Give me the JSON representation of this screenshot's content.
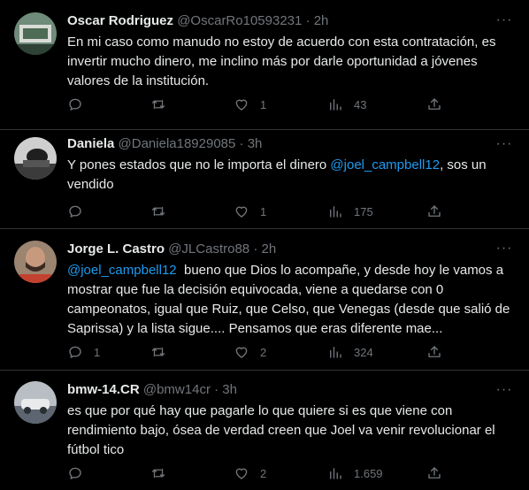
{
  "tweets": [
    {
      "name": "Oscar Rodriguez",
      "handle": "@OscarRo10593231",
      "separator": "·",
      "time": "2h",
      "text_parts": [
        {
          "text": "En mi caso como manudo no estoy de acuerdo con esta contratación, es invertir mucho dinero, me inclino más por darle oportunidad a jóvenes valores de la institución."
        }
      ],
      "replies": "",
      "retweets": "",
      "likes": "1",
      "views": "43",
      "avatar_colors": [
        "#4d6b55",
        "#d9dcd6"
      ]
    },
    {
      "name": "Daniela",
      "handle": "@Daniela18929085",
      "separator": "·",
      "time": "3h",
      "text_parts": [
        {
          "text": "Y pones estados que no le importa el dinero "
        },
        {
          "text": "@joel_campbell12",
          "mention": true
        },
        {
          "text": ", sos un vendido"
        }
      ],
      "replies": "",
      "retweets": "",
      "likes": "1",
      "views": "175",
      "avatar_colors": [
        "#3b3b3b",
        "#cfcfcf"
      ]
    },
    {
      "name": "Jorge L. Castro",
      "handle": "@JLCastro88",
      "separator": "·",
      "time": "2h",
      "text_parts": [
        {
          "text": "@joel_campbell12",
          "mention": true
        },
        {
          "text": "  bueno que Dios lo acompañe, y desde hoy le vamos a mostrar que fue la decisión equivocada, viene a quedarse con 0 campeonatos, igual que Ruiz, que Celso, que Venegas (desde que salió de Saprissa) y la lista sigue.... Pensamos que eras diferente mae..."
        }
      ],
      "replies": "1",
      "retweets": "",
      "likes": "2",
      "views": "324",
      "avatar_colors": [
        "#7a4a36",
        "#c3412f"
      ]
    },
    {
      "name": "bmw-14.CR",
      "handle": "@bmw14cr",
      "separator": "·",
      "time": "3h",
      "text_parts": [
        {
          "text": "es que por qué hay que pagarle lo que quiere si es que viene con rendimiento bajo, ósea de verdad creen que Joel va venir revolucionar el fútbol tico"
        }
      ],
      "replies": "",
      "retweets": "",
      "likes": "2",
      "views": "1.659",
      "avatar_colors": [
        "#9aa2aa",
        "#5d6670"
      ]
    }
  ],
  "more_glyph": "···",
  "colors": {
    "background": "#000000",
    "text": "#e7e9ea",
    "secondary": "#71767b",
    "mention": "#1d9bf0",
    "divider": "#2f3336"
  }
}
